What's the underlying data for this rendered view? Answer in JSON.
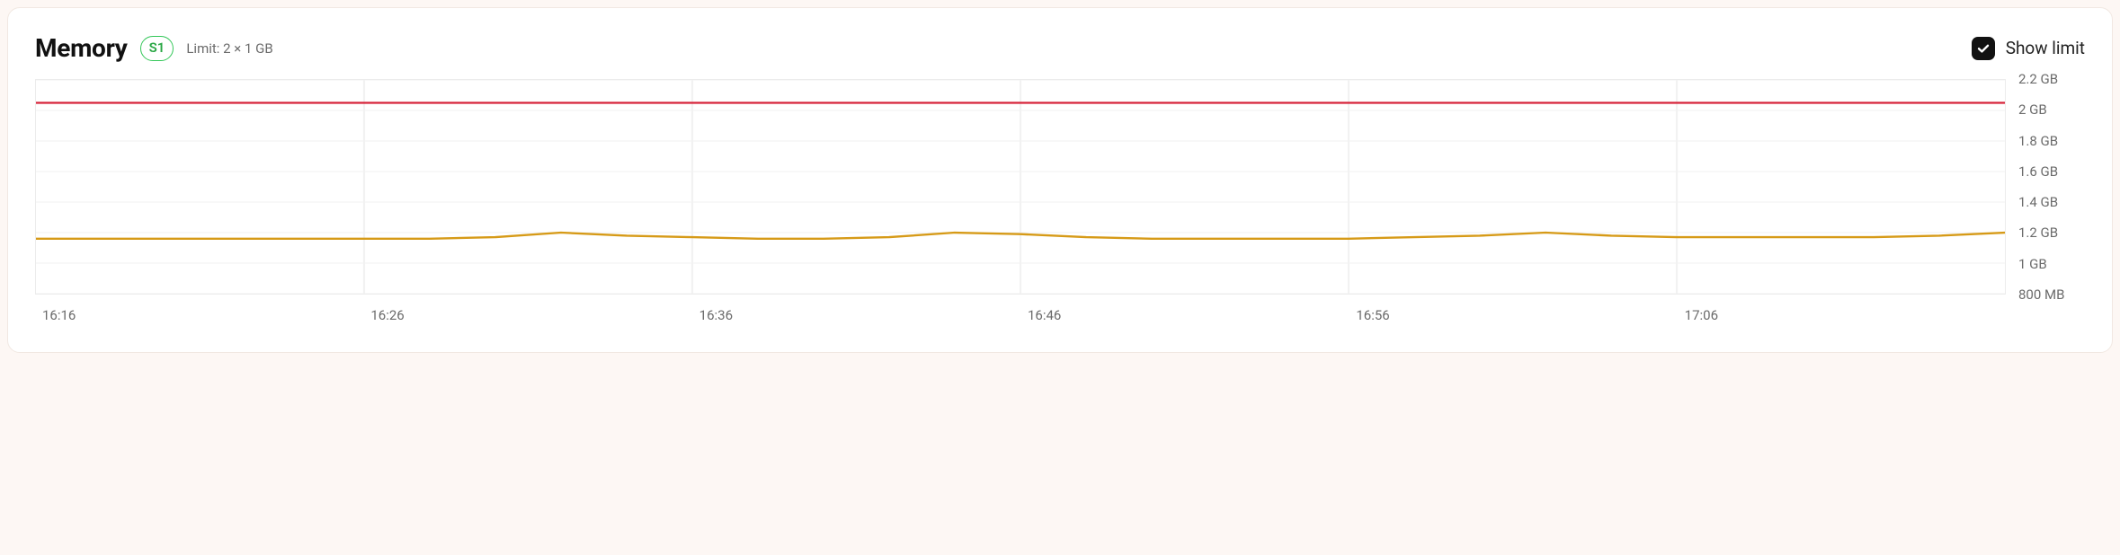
{
  "header": {
    "title": "Memory",
    "badge": "S1",
    "limit_text": "Limit: 2 × 1 GB",
    "show_limit_label": "Show limit",
    "show_limit_checked": true
  },
  "chart_data": {
    "type": "line",
    "title": "Memory",
    "xlabel": "",
    "ylabel": "",
    "y_unit": "GB",
    "ylim": [
      0.8,
      2.2
    ],
    "y_ticks": [
      {
        "v": 2.2,
        "label": "2.2 GB"
      },
      {
        "v": 2.0,
        "label": "2 GB"
      },
      {
        "v": 1.8,
        "label": "1.8 GB"
      },
      {
        "v": 1.6,
        "label": "1.6 GB"
      },
      {
        "v": 1.4,
        "label": "1.4 GB"
      },
      {
        "v": 1.2,
        "label": "1.2 GB"
      },
      {
        "v": 1.0,
        "label": "1 GB"
      },
      {
        "v": 0.8,
        "label": "800 MB"
      }
    ],
    "x_ticks": [
      "16:16",
      "16:26",
      "16:36",
      "16:46",
      "16:56",
      "17:06"
    ],
    "limit_value": 2.05,
    "series": [
      {
        "name": "memory",
        "color": "#d69a17",
        "x": [
          "16:16",
          "16:18",
          "16:20",
          "16:22",
          "16:24",
          "16:26",
          "16:28",
          "16:30",
          "16:32",
          "16:34",
          "16:36",
          "16:38",
          "16:40",
          "16:42",
          "16:44",
          "16:46",
          "16:48",
          "16:50",
          "16:52",
          "16:54",
          "16:56",
          "16:58",
          "17:00",
          "17:02",
          "17:04",
          "17:06",
          "17:08",
          "17:10",
          "17:12",
          "17:14",
          "17:16"
        ],
        "values": [
          1.16,
          1.16,
          1.16,
          1.16,
          1.16,
          1.16,
          1.16,
          1.17,
          1.2,
          1.18,
          1.17,
          1.16,
          1.16,
          1.17,
          1.2,
          1.19,
          1.17,
          1.16,
          1.16,
          1.16,
          1.16,
          1.17,
          1.18,
          1.2,
          1.18,
          1.17,
          1.17,
          1.17,
          1.17,
          1.18,
          1.2
        ]
      }
    ]
  }
}
